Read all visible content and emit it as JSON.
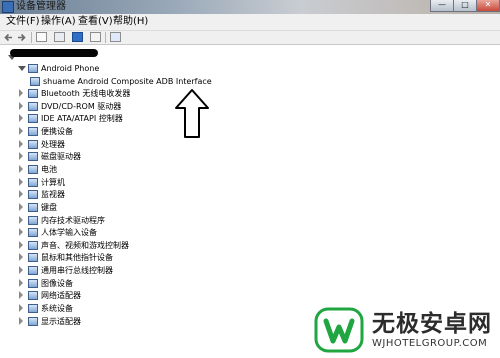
{
  "window": {
    "title": "设备管理器",
    "controls": [
      "—",
      "□",
      "✕"
    ]
  },
  "menu": [
    {
      "label": "文件(F)"
    },
    {
      "label": "操作(A)"
    },
    {
      "label": "查看(V)"
    },
    {
      "label": "帮助(H)"
    }
  ],
  "toolbar": {
    "icons": [
      "back-icon",
      "forward-icon",
      "properties-icon",
      "show-hide-icon",
      "help-icon",
      "details-icon",
      "scan-hardware-icon"
    ]
  },
  "tree": {
    "root_label": "",
    "open_group": {
      "label": "Android Phone"
    },
    "open_child": {
      "label": "shuame Android Composite ADB Interface"
    },
    "categories": [
      {
        "label": "Bluetooth 无线电收发器",
        "icon": "bluetooth-icon"
      },
      {
        "label": "DVD/CD-ROM 驱动器",
        "icon": "dvd-drive-icon"
      },
      {
        "label": "IDE ATA/ATAPI 控制器",
        "icon": "ide-controller-icon"
      },
      {
        "label": "便携设备",
        "icon": "portable-device-icon"
      },
      {
        "label": "处理器",
        "icon": "processor-icon"
      },
      {
        "label": "磁盘驱动器",
        "icon": "disk-drive-icon"
      },
      {
        "label": "电池",
        "icon": "battery-icon"
      },
      {
        "label": "计算机",
        "icon": "computer-icon"
      },
      {
        "label": "监视器",
        "icon": "monitor-icon"
      },
      {
        "label": "键盘",
        "icon": "keyboard-icon"
      },
      {
        "label": "内存技术驱动程序",
        "icon": "memory-icon"
      },
      {
        "label": "人体学输入设备",
        "icon": "hid-icon"
      },
      {
        "label": "声音、视频和游戏控制器",
        "icon": "sound-icon"
      },
      {
        "label": "鼠标和其他指针设备",
        "icon": "mouse-icon"
      },
      {
        "label": "通用串行总线控制器",
        "icon": "usb-icon"
      },
      {
        "label": "图像设备",
        "icon": "imaging-device-icon"
      },
      {
        "label": "网络适配器",
        "icon": "network-adapter-icon"
      },
      {
        "label": "系统设备",
        "icon": "system-device-icon"
      },
      {
        "label": "显示适配器",
        "icon": "display-adapter-icon"
      }
    ]
  },
  "watermark": {
    "brand": "无极安卓网",
    "url": "WJHOTELGROUP.COM"
  },
  "colors": {
    "icon_blue": "#3a6fb5",
    "watermark_green": "#1fa640"
  }
}
